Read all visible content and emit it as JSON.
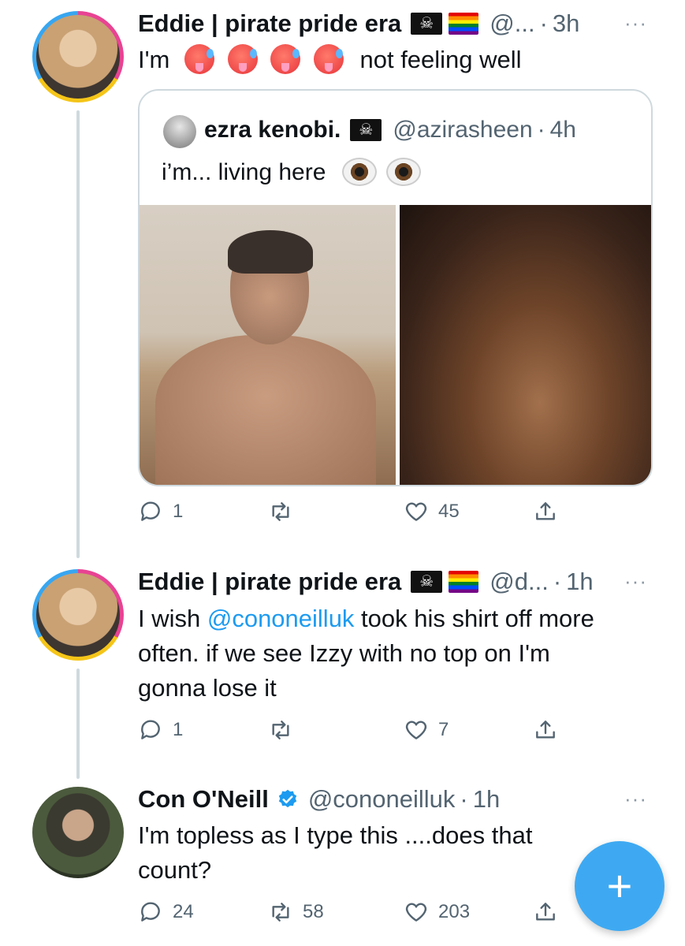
{
  "tweets": [
    {
      "name": "Eddie | pirate pride era",
      "handle": "@...",
      "time": "3h",
      "text_before": "I'm",
      "text_after": "not feeling well",
      "quote": {
        "name": "ezra kenobi.",
        "handle": "@azirasheen",
        "time": "4h",
        "text": "i’m... living here"
      },
      "reply_count": "1",
      "retweet_count": "",
      "like_count": "45"
    },
    {
      "name": "Eddie | pirate pride era",
      "handle": "@d...",
      "time": "1h",
      "text_part1": "I wish ",
      "mention": "@cononeilluk",
      "text_part2": " took his shirt off more",
      "line2": "often. if we see Izzy with no top on I'm",
      "line3": "gonna lose it",
      "reply_count": "1",
      "retweet_count": "",
      "like_count": "7"
    },
    {
      "name": "Con O'Neill",
      "handle": "@cononeilluk",
      "time": "1h",
      "line1": "I'm topless as I type this ....does that",
      "line2": "count?",
      "reply_count": "24",
      "retweet_count": "58",
      "like_count": "203"
    }
  ],
  "separator": "·",
  "more": "···",
  "fab_label": "+",
  "colors": {
    "link": "#1d9bf0",
    "secondary_text": "#536471",
    "thread_line": "#cfd9de",
    "fab": "#1d9bf0"
  }
}
